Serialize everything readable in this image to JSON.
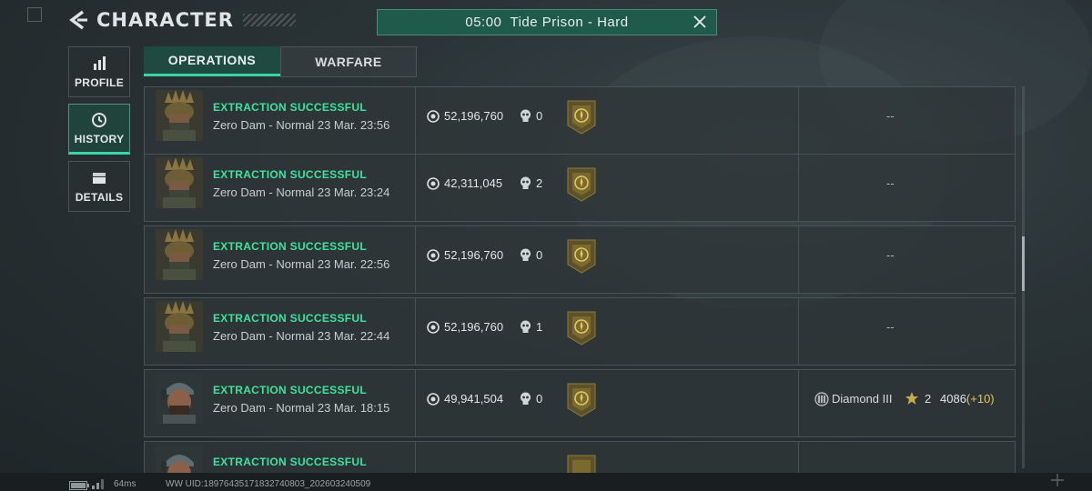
{
  "header": {
    "title": "CHARACTER"
  },
  "match_banner": {
    "text": "05:00  Tide Prison - Hard"
  },
  "side_nav": [
    {
      "label": "PROFILE",
      "icon": "bar-chart-icon",
      "active": false
    },
    {
      "label": "HISTORY",
      "icon": "clock-history-icon",
      "active": true
    },
    {
      "label": "DETAILS",
      "icon": "folder-icon",
      "active": false
    }
  ],
  "tabs": [
    {
      "label": "OPERATIONS",
      "active": true
    },
    {
      "label": "WARFARE",
      "active": false
    }
  ],
  "rows": [
    {
      "status": "EXTRACTION SUCCESSFUL",
      "map_time": "Zero Dam - Normal 23 Mar. 23:56",
      "value": "52,196,760",
      "kills": "0",
      "rank_text": "--",
      "avatar": "spiked-helmet"
    },
    {
      "status": "EXTRACTION SUCCESSFUL",
      "map_time": "Zero Dam - Normal 23 Mar. 23:24",
      "value": "42,311,045",
      "kills": "2",
      "rank_text": "--",
      "avatar": "spiked-helmet"
    },
    {
      "status": "EXTRACTION SUCCESSFUL",
      "map_time": "Zero Dam - Normal 23 Mar. 22:56",
      "value": "52,196,760",
      "kills": "0",
      "rank_text": "--",
      "avatar": "spiked-helmet"
    },
    {
      "status": "EXTRACTION SUCCESSFUL",
      "map_time": "Zero Dam - Normal 23 Mar. 22:44",
      "value": "52,196,760",
      "kills": "1",
      "rank_text": "--",
      "avatar": "spiked-helmet"
    },
    {
      "status": "EXTRACTION SUCCESSFUL",
      "map_time": "Zero Dam - Normal 23 Mar. 18:15",
      "value": "49,941,504",
      "kills": "0",
      "rank_name": "Diamond III",
      "stars": "2",
      "score": "4086",
      "score_delta": "(+10)",
      "avatar": "cap-headset"
    },
    {
      "status": "EXTRACTION SUCCESSFUL",
      "map_time": "",
      "value": "",
      "kills": "",
      "avatar": "cap-headset"
    }
  ],
  "footer": {
    "ping": "64ms",
    "uid": "WW UID:18976435171832740803_202603240509"
  },
  "colors": {
    "accent": "#39d6a2",
    "status_green": "#3ce39e",
    "delta_gold": "#e8c45a",
    "banner_bg": "#1f5a4a"
  }
}
